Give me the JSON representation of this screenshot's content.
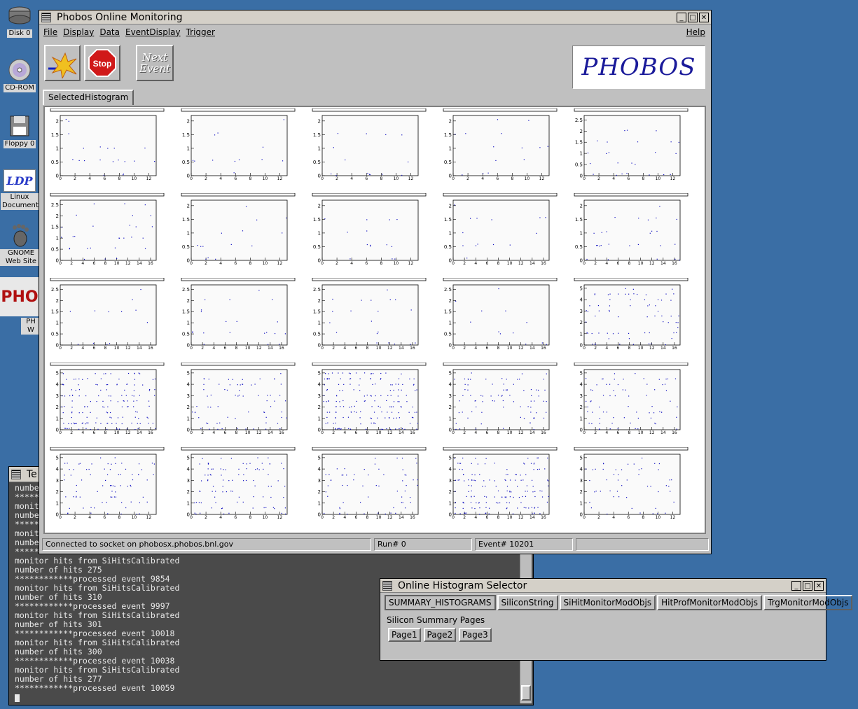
{
  "desktop": {
    "icons": [
      {
        "label": "Disk 0",
        "icon": "hard-disk-icon"
      },
      {
        "label": "CD-ROM",
        "icon": "cd-rom-icon"
      },
      {
        "label": "Floppy 0",
        "icon": "floppy-icon"
      },
      {
        "label": "Linux Documents",
        "icon": "ldp-icon",
        "glyph_text": "LDP"
      },
      {
        "label": "GNOME Web Site",
        "icon": "gnome-foot-icon"
      },
      {
        "label": "PH W",
        "icon": "phobos-desktop-icon",
        "glyph_text": "PHO"
      }
    ]
  },
  "main_window": {
    "title": "Phobos Online Monitoring",
    "menu_left": [
      "File",
      "Display",
      "Data",
      "EventDisplay",
      "Trigger"
    ],
    "menu_right": "Help",
    "toolbar": {
      "start_icon": "start-run-icon",
      "stop_label": "Stop",
      "next_event_label": "Next Event"
    },
    "logo_text": "PHOBOS",
    "tab_label": "SelectedHistogram",
    "status": {
      "connection": "Connected to socket on phobosx.phobos.bnl.gov",
      "run": "Run# 0",
      "event": "Event# 10201"
    }
  },
  "histograms": {
    "rows": [
      {
        "yticks": [
          [
            "0",
            "0.5",
            "1",
            "1.5",
            "2"
          ],
          [
            "0",
            "0.5",
            "1",
            "1.5",
            "2"
          ],
          [
            "0",
            "0.5",
            "1",
            "1.5",
            "2"
          ],
          [
            "0",
            "0.5",
            "1",
            "1.5",
            "2"
          ],
          [
            "0",
            "0.5",
            "1",
            "1.5",
            "2",
            "2.5"
          ]
        ],
        "xticks": [
          [
            "0",
            "2",
            "4",
            "6",
            "8",
            "10",
            "12"
          ],
          [
            "0",
            "2",
            "4",
            "6",
            "8",
            "10",
            "12"
          ],
          [
            "0",
            "2",
            "4",
            "6",
            "8",
            "10",
            "12"
          ],
          [
            "0",
            "2",
            "4",
            "6",
            "8",
            "10",
            "12"
          ],
          [
            "0",
            "2",
            "4",
            "6",
            "8",
            "10",
            "12"
          ]
        ],
        "ymax": [
          2.2,
          2.2,
          2.2,
          2.2,
          2.7
        ],
        "xmax": [
          13,
          13,
          13,
          13,
          13
        ],
        "density": [
          20,
          12,
          14,
          14,
          24
        ]
      },
      {
        "yticks": [
          [
            "0",
            "0.5",
            "1",
            "1.5",
            "2",
            "2.5"
          ],
          [
            "0",
            "0.5",
            "1",
            "1.5",
            "2"
          ],
          [
            "0",
            "0.5",
            "1",
            "1.5",
            "2"
          ],
          [
            "0",
            "0.5",
            "1",
            "1.5",
            "2"
          ],
          [
            "0",
            "0.5",
            "1",
            "1.5",
            "2"
          ]
        ],
        "xticks": [
          [
            "0",
            "2",
            "4",
            "6",
            "8",
            "10",
            "12",
            "14",
            "16"
          ],
          [
            "0",
            "2",
            "4",
            "6",
            "8",
            "10",
            "12"
          ],
          [
            "0",
            "2",
            "4",
            "6",
            "8",
            "10",
            "12"
          ],
          [
            "0",
            "2",
            "4",
            "6",
            "8",
            "10",
            "12",
            "14",
            "16"
          ],
          [
            "0",
            "2",
            "4",
            "6",
            "8",
            "10",
            "12",
            "14",
            "16"
          ]
        ],
        "ymax": [
          2.7,
          2.2,
          2.2,
          2.2,
          2.2
        ],
        "xmax": [
          17,
          13,
          13,
          17,
          17
        ],
        "density": [
          28,
          14,
          14,
          14,
          26
        ]
      },
      {
        "yticks": [
          [
            "0",
            "0.5",
            "1",
            "1.5",
            "2",
            "2.5"
          ],
          [
            "0",
            "0.5",
            "1",
            "1.5",
            "2",
            "2.5"
          ],
          [
            "0",
            "0.5",
            "1",
            "1.5",
            "2",
            "2.5"
          ],
          [
            "0",
            "0.5",
            "1",
            "1.5",
            "2",
            "2.5"
          ],
          [
            "0",
            "1",
            "2",
            "3",
            "4",
            "5"
          ]
        ],
        "xticks": [
          [
            "0",
            "2",
            "4",
            "6",
            "8",
            "10",
            "12",
            "14",
            "16"
          ],
          [
            "0",
            "2",
            "4",
            "6",
            "8",
            "10",
            "12",
            "14",
            "16"
          ],
          [
            "0",
            "2",
            "4",
            "6",
            "8",
            "10",
            "12",
            "14",
            "16"
          ],
          [
            "0",
            "2",
            "4",
            "6",
            "8",
            "10",
            "12",
            "14",
            "16"
          ],
          [
            "0",
            "2",
            "4",
            "6",
            "8",
            "10",
            "12",
            "14",
            "16"
          ]
        ],
        "ymax": [
          2.7,
          2.7,
          2.7,
          2.7,
          5.3
        ],
        "xmax": [
          17,
          17,
          17,
          17,
          17
        ],
        "density": [
          12,
          20,
          20,
          12,
          70
        ]
      },
      {
        "yticks": [
          [
            "0",
            "1",
            "2",
            "3",
            "4",
            "5"
          ],
          [
            "0",
            "1",
            "2",
            "3",
            "4",
            "5"
          ],
          [
            "0",
            "1",
            "2",
            "3",
            "4",
            "5"
          ],
          [
            "0",
            "1",
            "2",
            "3",
            "4",
            "5"
          ],
          [
            "0",
            "1",
            "2",
            "3",
            "4",
            "5"
          ]
        ],
        "xticks": [
          [
            "0",
            "2",
            "4",
            "6",
            "8",
            "10",
            "12",
            "14",
            "16"
          ],
          [
            "0",
            "2",
            "4",
            "6",
            "8",
            "10",
            "12",
            "14",
            "16"
          ],
          [
            "0",
            "2",
            "4",
            "6",
            "8",
            "10",
            "12",
            "14",
            "16"
          ],
          [
            "0",
            "2",
            "4",
            "6",
            "8",
            "10",
            "12",
            "14",
            "16"
          ],
          [
            "0",
            "2",
            "4",
            "6",
            "8",
            "10",
            "12",
            "14",
            "16"
          ]
        ],
        "ymax": [
          5.3,
          5.3,
          5.3,
          5.3,
          5.3
        ],
        "xmax": [
          17,
          17,
          17,
          17,
          17
        ],
        "density": [
          150,
          70,
          170,
          80,
          70
        ]
      },
      {
        "yticks": [
          [
            "0",
            "1",
            "2",
            "3",
            "4",
            "5"
          ],
          [
            "0",
            "1",
            "2",
            "3",
            "4",
            "5"
          ],
          [
            "0",
            "1",
            "2",
            "3",
            "4",
            "5"
          ],
          [
            "0",
            "1",
            "2",
            "3",
            "4",
            "5"
          ],
          [
            "0",
            "1",
            "2",
            "3",
            "4",
            "5"
          ]
        ],
        "xticks": [
          [
            "0",
            "2",
            "4",
            "6",
            "8",
            "10",
            "12"
          ],
          [
            "0",
            "2",
            "4",
            "6",
            "8",
            "10",
            "12"
          ],
          [
            "0",
            "2",
            "4",
            "6",
            "8",
            "10",
            "12",
            "14",
            "16"
          ],
          [
            "0",
            "2",
            "4",
            "6",
            "8",
            "10",
            "12",
            "14",
            "16"
          ],
          [
            "0",
            "2",
            "4",
            "6",
            "8",
            "10",
            "12"
          ]
        ],
        "ymax": [
          5.3,
          5.3,
          5.3,
          5.3,
          5.3
        ],
        "xmax": [
          13,
          13,
          17,
          17,
          13
        ],
        "density": [
          80,
          90,
          60,
          150,
          50
        ]
      }
    ]
  },
  "terminal": {
    "title": "Te",
    "partial_lines": [
      "numbe",
      "*****",
      "monit",
      "numbe",
      "*****",
      "monit",
      "numbe",
      "*****"
    ],
    "lines": [
      "monitor hits from SiHitsCalibrated",
      "number of hits 275",
      "************processed event 9854",
      "monitor hits from SiHitsCalibrated",
      "number of hits 310",
      "************processed event 9997",
      "monitor hits from SiHitsCalibrated",
      "number of hits 301",
      "************processed event 10018",
      "monitor hits from SiHitsCalibrated",
      "number of hits 300",
      "************processed event 10038",
      "monitor hits from SiHitsCalibrated",
      "number of hits 277",
      "************processed event 10059"
    ]
  },
  "selector_window": {
    "title": "Online Histogram Selector",
    "tabs": [
      "SUMMARY_HISTOGRAMS",
      "SiliconString",
      "SiHitMonitorModObjs",
      "HitProfMonitorModObjs",
      "TrgMonitorModObjs"
    ],
    "section_label": "Silicon Summary Pages",
    "pages": [
      "Page1",
      "Page2",
      "Page3"
    ]
  },
  "colors": {
    "desktop": "#3a6ea5",
    "window": "#c0c0c0",
    "terminal_bg": "#4a4a4a",
    "data_points": "#1010c0"
  }
}
